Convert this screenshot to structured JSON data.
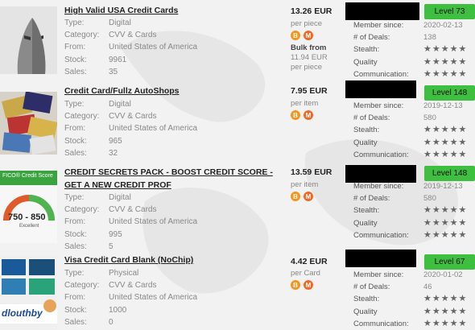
{
  "labels": {
    "type": "Type:",
    "category": "Category:",
    "from": "From:",
    "stock": "Stock:",
    "sales": "Sales:",
    "member_since": "Member since:",
    "deals": "# of Deals:",
    "stealth": "Stealth:",
    "quality": "Quality",
    "communication": "Communication:"
  },
  "listings": [
    {
      "title": "High Valid USA Credit Cards",
      "type": "Digital",
      "category": "CVV & Cards",
      "from": "United States of America",
      "stock": "9961",
      "sales": "35",
      "price": "13.26 EUR",
      "unit": "per piece",
      "bulk_label": "Bulk from",
      "bulk_price": "11.94 EUR",
      "bulk_unit": "per piece",
      "level": "Level 73",
      "member_since": "2020-02-13",
      "deals": "138",
      "stars": "★★★★★"
    },
    {
      "title": "Credit Card/Fullz AutoShops",
      "type": "Digital",
      "category": "CVV & Cards",
      "from": "United States of America",
      "stock": "965",
      "sales": "32",
      "price": "7.95 EUR",
      "unit": "per item",
      "level": "Level 148",
      "member_since": "2019-12-13",
      "deals": "580",
      "stars": "★★★★★"
    },
    {
      "title": "CREDIT SECRETS PACK - BOOST CREDIT SCORE - GET A NEW CREDIT PROF",
      "type": "Digital",
      "category": "CVV & Cards",
      "from": "United States of America",
      "stock": "995",
      "sales": "5",
      "price": "13.59 EUR",
      "unit": "per item",
      "level": "Level 148",
      "member_since": "2019-12-13",
      "deals": "580",
      "stars": "★★★★★",
      "thumb_text": "FICO® Credit Score",
      "thumb_range": "750 - 850",
      "thumb_sub": "Excellent"
    },
    {
      "title": "Visa Credit Card Blank (NoChip)",
      "type": "Physical",
      "category": "CVV & Cards",
      "from": "United States of America",
      "stock": "1000",
      "sales": "0",
      "price": "4.42 EUR",
      "unit": "per Card",
      "level": "Level 67",
      "member_since": "2020-01-02",
      "deals": "46",
      "stars": "★★★★★",
      "thumb_text": "dlouthby"
    }
  ],
  "coins": {
    "btc": "B",
    "xmr": "M"
  },
  "colors": {
    "level_badge": "#3fbf3f",
    "btc": "#f7931a",
    "xmr": "#f26822"
  }
}
